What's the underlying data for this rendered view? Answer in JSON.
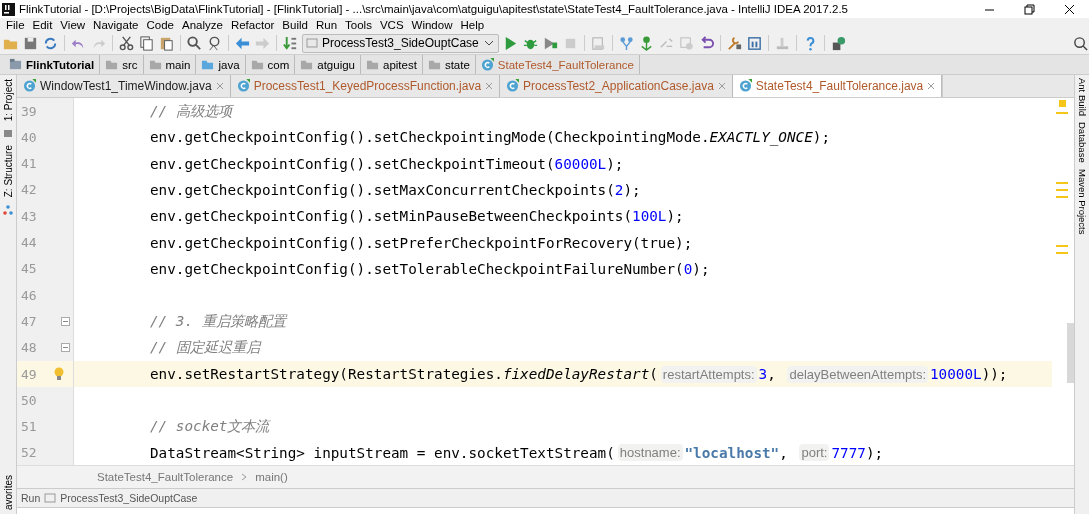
{
  "window": {
    "title": "FlinkTutorial - [D:\\Projects\\BigData\\FlinkTutorial] - [FlinkTutorial] - ...\\src\\main\\java\\com\\atguigu\\apitest\\state\\StateTest4_FaultTolerance.java - IntelliJ IDEA 2017.2.5"
  },
  "menu": [
    "File",
    "Edit",
    "View",
    "Navigate",
    "Code",
    "Analyze",
    "Refactor",
    "Build",
    "Run",
    "Tools",
    "VCS",
    "Window",
    "Help"
  ],
  "toolbar": {
    "run_config": "ProcessTest3_SideOuptCase"
  },
  "nav_bar": [
    {
      "label": "FlinkTutorial",
      "kind": "project"
    },
    {
      "label": "src",
      "kind": "folder"
    },
    {
      "label": "main",
      "kind": "folder"
    },
    {
      "label": "java",
      "kind": "source"
    },
    {
      "label": "com",
      "kind": "folder"
    },
    {
      "label": "atguigu",
      "kind": "folder"
    },
    {
      "label": "apitest",
      "kind": "folder"
    },
    {
      "label": "state",
      "kind": "folder"
    },
    {
      "label": "StateTest4_FaultTolerance",
      "kind": "class"
    }
  ],
  "tabs": [
    {
      "label": "WindowTest1_TimeWindow.java",
      "color": "#222222",
      "selected": false
    },
    {
      "label": "ProcessTest1_KeyedProcessFunction.java",
      "color": "#b05a2c",
      "selected": false
    },
    {
      "label": "ProcessTest2_ApplicationCase.java",
      "color": "#b05a2c",
      "selected": false
    },
    {
      "label": "StateTest4_FaultTolerance.java",
      "color": "#b05a2c",
      "selected": true
    }
  ],
  "left_tool_windows": [
    "1: Project",
    "Z: Structure"
  ],
  "right_tool_windows": [
    "Ant Build",
    "Database",
    "Maven Projects"
  ],
  "editor": {
    "lines": [
      {
        "number": "39",
        "tokens": [
          {
            "t": "// 高级选项",
            "kind": "comment"
          }
        ]
      },
      {
        "number": "40",
        "tokens": [
          {
            "t": "env.getCheckpointConfig().setCheckpointingMode(CheckpointingMode.",
            "kind": "plain"
          },
          {
            "t": "EXACTLY_ONCE",
            "kind": "static"
          },
          {
            "t": ");",
            "kind": "plain"
          }
        ]
      },
      {
        "number": "41",
        "tokens": [
          {
            "t": "env.getCheckpointConfig().setCheckpointTimeout(",
            "kind": "plain"
          },
          {
            "t": "60000L",
            "kind": "number"
          },
          {
            "t": ");",
            "kind": "plain"
          }
        ]
      },
      {
        "number": "42",
        "tokens": [
          {
            "t": "env.getCheckpointConfig().setMaxConcurrentCheckpoints(",
            "kind": "plain"
          },
          {
            "t": "2",
            "kind": "number"
          },
          {
            "t": ");",
            "kind": "plain"
          }
        ]
      },
      {
        "number": "43",
        "tokens": [
          {
            "t": "env.getCheckpointConfig().setMinPauseBetweenCheckpoints(",
            "kind": "plain"
          },
          {
            "t": "100L",
            "kind": "number"
          },
          {
            "t": ");",
            "kind": "plain"
          }
        ]
      },
      {
        "number": "44",
        "tokens": [
          {
            "t": "env.getCheckpointConfig().setPreferCheckpointForRecovery(true);",
            "kind": "plain"
          }
        ]
      },
      {
        "number": "45",
        "tokens": [
          {
            "t": "env.getCheckpointConfig().setTolerableCheckpointFailureNumber(",
            "kind": "plain"
          },
          {
            "t": "0",
            "kind": "number"
          },
          {
            "t": ");",
            "kind": "plain"
          }
        ]
      },
      {
        "number": "46"
      },
      {
        "number": "47",
        "fold": true,
        "tokens": [
          {
            "t": "// 3. 重启策略配置",
            "kind": "comment"
          }
        ]
      },
      {
        "number": "48",
        "fold": true,
        "tokens": [
          {
            "t": "// 固定延迟重启",
            "kind": "comment"
          }
        ]
      },
      {
        "number": "49",
        "current": true,
        "bulb": true,
        "tokens": [
          {
            "t": "env.setRestartStrategy(RestartStrategies.",
            "kind": "plain"
          },
          {
            "t": "fixedDelayRestart",
            "kind": "static"
          },
          {
            "t": "(",
            "kind": "plain"
          },
          {
            "t": "restartAttempts:",
            "kind": "hint"
          },
          {
            "t": "3",
            "kind": "number"
          },
          {
            "t": ", ",
            "kind": "plain"
          },
          {
            "t": "delayBetweenAttempts:",
            "kind": "hint"
          },
          {
            "t": "10000L",
            "kind": "number"
          },
          {
            "t": "));",
            "kind": "plain"
          }
        ]
      },
      {
        "number": "50"
      },
      {
        "number": "51",
        "tokens": [
          {
            "t": "// socket文本流",
            "kind": "comment"
          }
        ]
      },
      {
        "number": "52",
        "tokens": [
          {
            "t": "DataStream<String> inputStream = env.socketTextStream(",
            "kind": "plain"
          },
          {
            "t": "hostname:",
            "kind": "hint"
          },
          {
            "t": "\"localhost\"",
            "kind": "string"
          },
          {
            "t": ", ",
            "kind": "plain"
          },
          {
            "t": "port:",
            "kind": "hint"
          },
          {
            "t": "7777",
            "kind": "number"
          },
          {
            "t": ");",
            "kind": "plain"
          }
        ]
      }
    ]
  },
  "breadcrumbs": [
    "StateTest4_FaultTolerance",
    "main()"
  ],
  "run_bar": {
    "label": "Run",
    "config": "ProcessTest3_SideOuptCase"
  },
  "favorites_label": "avorites"
}
